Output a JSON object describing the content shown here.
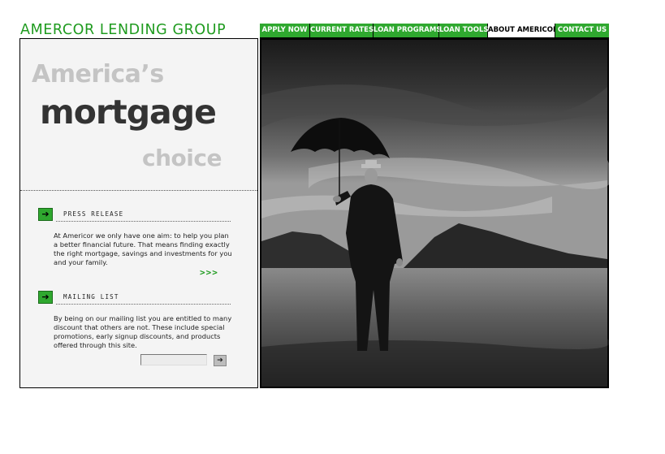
{
  "header": {
    "logo_text": "AMERCOR LENDING GROUP"
  },
  "nav": {
    "items": [
      {
        "label": "APPLY NOW",
        "active": false
      },
      {
        "label": "CURRENT RATES",
        "active": false
      },
      {
        "label": "LOAN PROGRAMS",
        "active": false
      },
      {
        "label": "LOAN TOOLS",
        "active": false
      },
      {
        "label": "ABOUT AMERICOR",
        "active": true
      },
      {
        "label": "CONTACT US",
        "active": false
      }
    ]
  },
  "hero": {
    "line1": "America’s",
    "line2": "mortgage",
    "line3": "choice"
  },
  "press_release": {
    "title": "PRESS RELEASE",
    "body": "At Americor we only have one aim: to help you plan a better financial future. That means finding exactly the right mortgage, savings and investments for you and your family.",
    "more_link": ">>>",
    "arrow_icon": "arrow-right-icon"
  },
  "mailing_list": {
    "title": "MAILING LIST",
    "body": "By being on our mailing list you are entitled to many discount that others are not. These include special promotions, early signup discounts, and products offered through this site.",
    "email_value": "",
    "submit_icon": "arrow-right-icon"
  },
  "colors": {
    "brand_green": "#2fa82f",
    "logo_green": "#1f9b1f",
    "panel_bg": "#f4f4f4"
  }
}
